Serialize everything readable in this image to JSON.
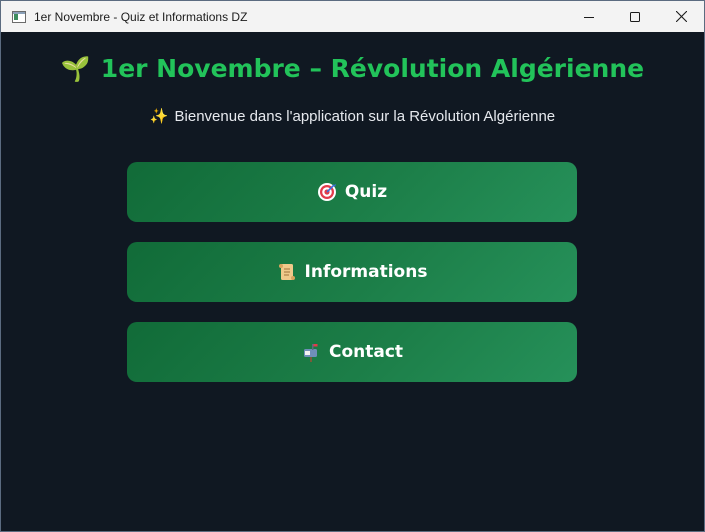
{
  "window": {
    "title": "1er Novembre - Quiz et Informations DZ",
    "controls": [
      "minimize-icon",
      "maximize-icon",
      "close-icon"
    ]
  },
  "header": {
    "emoji": "🌱",
    "emoji_icon": "seedling-icon",
    "title": "1er Novembre – Révolution Algérienne"
  },
  "subtitle": {
    "emoji": "✨",
    "emoji_icon": "sparkles-icon",
    "text": "Bienvenue dans l'application sur la Révolution Algérienne"
  },
  "menu": {
    "quiz": {
      "label": "Quiz",
      "icon": "target-icon"
    },
    "informations": {
      "label": "Informations",
      "icon": "scroll-icon"
    },
    "contact": {
      "label": "Contact",
      "icon": "mailbox-icon"
    }
  },
  "colors": {
    "background": "#101822",
    "title_green": "#22c35a",
    "button_green_start": "#116b38",
    "button_green_end": "#26915a",
    "text_light": "#e6e9ee"
  }
}
